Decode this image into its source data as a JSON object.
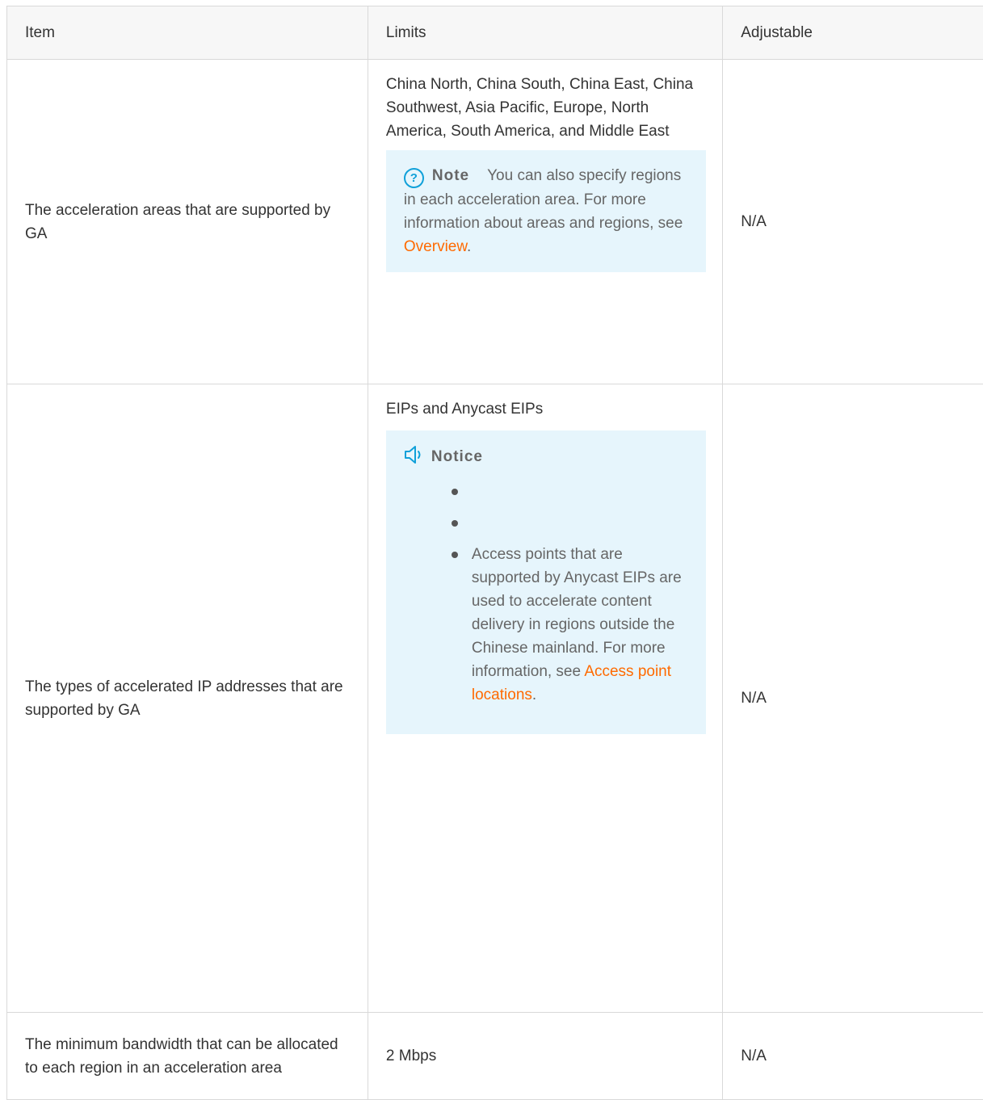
{
  "table": {
    "headers": {
      "item": "Item",
      "limits": "Limits",
      "adjustable": "Adjustable"
    },
    "rows": [
      {
        "item": "The acceleration areas that are supported by GA",
        "limits": "China North, China South, China East, China Southwest, Asia Pacific, Europe, North America, South America, and Middle East",
        "note": {
          "title": "Note",
          "text": "You can also specify regions in each acceleration area. For more information about areas and regions, see ",
          "link": "Overview",
          "suffix": "."
        },
        "adjustable": "N/A"
      },
      {
        "item": "The types of accelerated IP addresses that are supported by GA",
        "limits": "EIPs and Anycast EIPs",
        "notice": {
          "title": "Notice",
          "items": [
            "",
            "",
            "Access points that are supported by Anycast EIPs are used to accelerate content delivery in regions outside the Chinese mainland. For more information, see "
          ],
          "link": "Access point locations",
          "suffix": "."
        },
        "adjustable": "N/A"
      },
      {
        "item": "The minimum bandwidth that can be allocated to each region in an acceleration area",
        "limits": "2 Mbps",
        "adjustable": "N/A"
      }
    ]
  },
  "icons": {
    "note": "help-circle-icon",
    "notice": "speaker-icon",
    "accent": "#0fa0d9",
    "link_color": "#ff6a00",
    "callout_bg": "#e6f5fc"
  }
}
